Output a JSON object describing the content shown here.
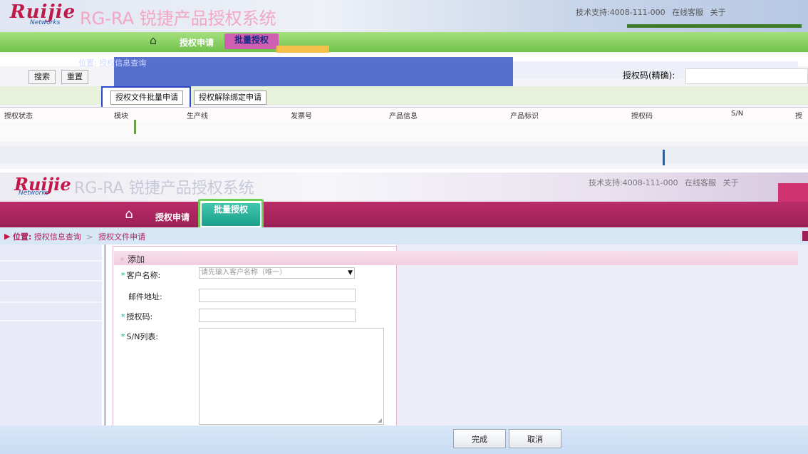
{
  "top_panel": {
    "logo": "Ruijie",
    "logo_sub": "Networks",
    "system_title": "RG-RA 锐捷产品授权系统",
    "top_links": [
      "技术支持:4008-111-000",
      "在线客服",
      "关于"
    ],
    "nav": {
      "home_icon": "home-icon",
      "items": [
        "授权申请",
        "批量授权"
      ],
      "active": "批量授权"
    },
    "breadcrumb": "位置: 授权信息查询",
    "buttons": {
      "search": "搜索",
      "reset": "重置"
    },
    "auth_code_label": "授权码(精确):",
    "auth_code_value": "",
    "tabs": [
      "授权文件批量申请",
      "授权解除绑定申请"
    ],
    "table_headers": [
      "授权状态",
      "",
      "模块",
      "",
      "生产线",
      "",
      "发票号",
      "",
      "产品信息",
      "",
      "产品标识",
      "",
      "授权码",
      "",
      "S/N",
      "",
      "授"
    ]
  },
  "bottom_panel": {
    "logo": "Ruijie",
    "logo_sub": "Networks",
    "system_title": "RG-RA 锐捷产品授权系统",
    "top_links": [
      "技术支持:4008-111-000",
      "在线客服",
      "关于"
    ],
    "nav": {
      "home_icon": "home-icon",
      "items": [
        "授权申请",
        "批量授权"
      ],
      "active": "批量授权"
    },
    "breadcrumb": {
      "label": "位置:",
      "parts": [
        "授权信息查询",
        "授权文件申请"
      ],
      "separator": ">"
    },
    "form": {
      "title": "添加",
      "customer_label": "客户名称:",
      "customer_placeholder": "请先输入客户名称（唯一）",
      "email_label": "邮件地址:",
      "email_value": "",
      "auth_code_label": "授权码:",
      "auth_code_value": "",
      "sn_label": "S/N列表:",
      "sn_value": ""
    },
    "footer": {
      "done": "完成",
      "cancel": "取消"
    }
  }
}
